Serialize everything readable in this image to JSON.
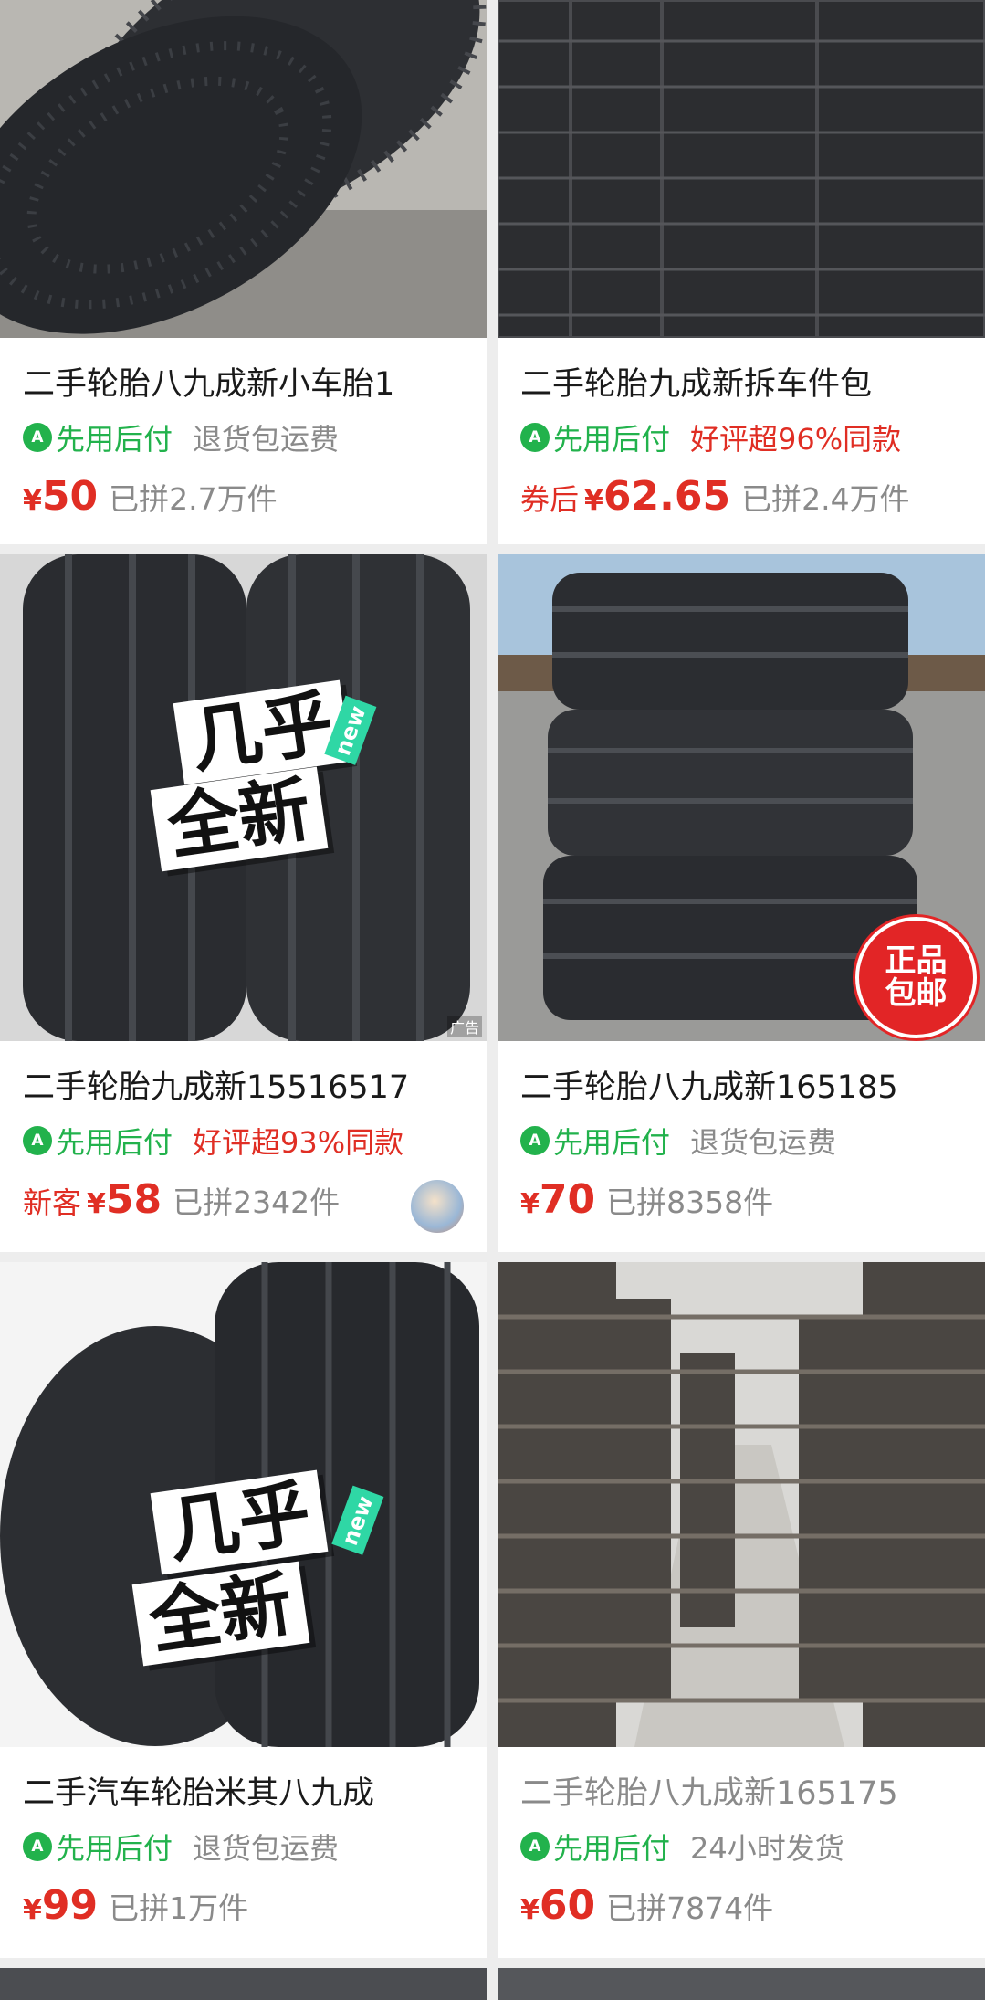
{
  "products": [
    {
      "title": "二手轮胎八九成新小车胎1",
      "pay_label": "先用后付",
      "tag2": "退货包运费",
      "tag2_color": "gray",
      "prefix": "",
      "yen": "¥",
      "price": "50",
      "sold": "已拼2.7万件"
    },
    {
      "title": "二手轮胎九成新拆车件包",
      "pay_label": "先用后付",
      "tag2": "好评超96%同款",
      "tag2_color": "red",
      "prefix": "券后",
      "yen": "¥",
      "price": "62.65",
      "sold": "已拼2.4万件"
    },
    {
      "title": "二手轮胎九成新15516517",
      "pay_label": "先用后付",
      "tag2": "好评超93%同款",
      "tag2_color": "red",
      "prefix": "新客",
      "yen": "¥",
      "price": "58",
      "sold": "已拼2342件",
      "image_badge": "几乎",
      "image_badge2": "全新",
      "image_new": "new",
      "ad_label": "广告"
    },
    {
      "title": "二手轮胎八九成新165185",
      "pay_label": "先用后付",
      "tag2": "退货包运费",
      "tag2_color": "gray",
      "prefix": "",
      "yen": "¥",
      "price": "70",
      "sold": "已拼8358件",
      "stamp_line1": "正品",
      "stamp_line2": "包邮"
    },
    {
      "title": "二手汽车轮胎米其八九成",
      "pay_label": "先用后付",
      "tag2": "退货包运费",
      "tag2_color": "gray",
      "prefix": "",
      "yen": "¥",
      "price": "99",
      "sold": "已拼1万件",
      "image_badge": "几乎",
      "image_badge2": "全新",
      "image_new": "new"
    },
    {
      "title": "二手轮胎八九成新165175",
      "pay_label": "先用后付",
      "tag2": "24小时发货",
      "tag2_color": "gray",
      "prefix": "",
      "yen": "¥",
      "price": "60",
      "sold": "已拼7874件"
    }
  ],
  "icons": {
    "pay": "pay-later-icon"
  },
  "colors": {
    "price": "#e02e24",
    "pay": "#22b24c",
    "muted": "#8a8a8a",
    "accent_new": "#2fd7a5"
  }
}
